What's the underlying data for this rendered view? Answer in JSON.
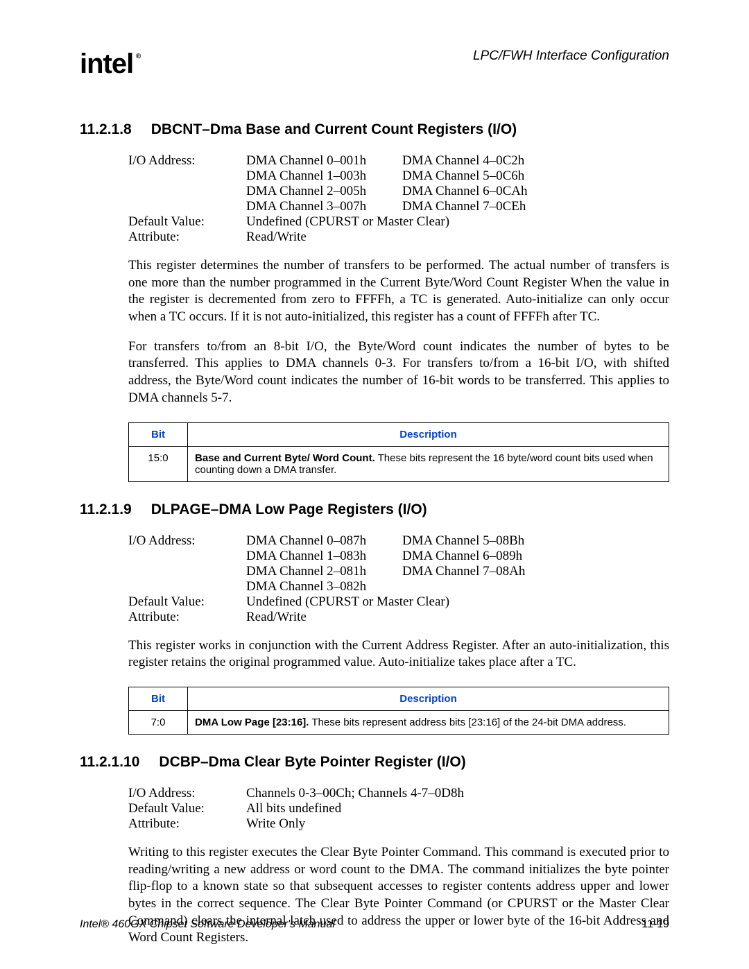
{
  "header": {
    "logo_text": "intel",
    "reg": "®",
    "right": "LPC/FWH Interface Configuration"
  },
  "table_headers": {
    "bit": "Bit",
    "desc": "Description"
  },
  "s1": {
    "num": "11.2.1.8",
    "title": "DBCNT–Dma Base and Current Count Registers (I/O)",
    "kv": {
      "io_label": "I/O Address:",
      "cols": [
        [
          "DMA Channel 0–001h",
          "DMA Channel 1–003h",
          "DMA Channel 2–005h",
          "DMA Channel 3–007h"
        ],
        [
          "DMA Channel 4–0C2h",
          "DMA Channel 5–0C6h",
          "DMA Channel 6–0CAh",
          "DMA Channel 7–0CEh"
        ]
      ],
      "dv_label": "Default Value:",
      "dv_value": "Undefined (CPURST or Master Clear)",
      "attr_label": "Attribute:",
      "attr_value": "Read/Write"
    },
    "p1": "This register determines the number of transfers to be performed. The actual number of transfers is one more than the number programmed in the Current Byte/Word Count Register When the value in the register is decremented from zero to FFFFh, a TC is generated. Auto-initialize can only occur when a TC occurs. If it is not auto-initialized, this register has a count of FFFFh after TC.",
    "p2": "For transfers to/from an 8-bit I/O, the Byte/Word count indicates the number of bytes to be transferred. This applies to DMA channels 0-3. For transfers to/from a 16-bit I/O, with shifted address, the Byte/Word count indicates the number of 16-bit words to be transferred. This applies to DMA channels 5-7.",
    "row": {
      "bit": "15:0",
      "bold": "Base and Current Byte/ Word Count.",
      "rest": " These bits represent the 16 byte/word count bits used when counting down a DMA transfer."
    }
  },
  "s2": {
    "num": "11.2.1.9",
    "title": "DLPAGE–DMA Low Page Registers (I/O)",
    "kv": {
      "io_label": "I/O Address:",
      "cols": [
        [
          "DMA Channel 0–087h",
          "DMA Channel 1–083h",
          "DMA Channel 2–081h",
          "DMA Channel 3–082h"
        ],
        [
          "DMA Channel 5–08Bh",
          "DMA Channel 6–089h",
          "DMA Channel 7–08Ah"
        ]
      ],
      "dv_label": "Default Value:",
      "dv_value": "Undefined (CPURST or Master Clear)",
      "attr_label": "Attribute:",
      "attr_value": "Read/Write"
    },
    "p1": "This register works in conjunction with the Current Address Register. After an auto-initialization, this register retains the original programmed value. Auto-initialize takes place after a TC.",
    "row": {
      "bit": "7:0",
      "bold": "DMA Low Page [23:16].",
      "rest": " These bits represent address bits [23:16] of the 24-bit DMA address."
    }
  },
  "s3": {
    "num": "11.2.1.10",
    "title": "DCBP–Dma Clear Byte Pointer Register (I/O)",
    "kv": {
      "io_label": "I/O Address:",
      "io_value": "Channels 0-3–00Ch; Channels 4-7–0D8h",
      "dv_label": "Default Value:",
      "dv_value": "All bits undefined",
      "attr_label": "Attribute:",
      "attr_value": "Write Only"
    },
    "p1": "Writing to this register executes the Clear Byte Pointer Command. This command is executed prior to reading/writing a new address or word count to the DMA. The command initializes the byte pointer flip-flop to a known state so that subsequent accesses to register contents address upper and lower bytes in the correct sequence. The Clear Byte Pointer Command (or CPURST or the Master Clear Command) clears the internal latch used to address the upper or lower byte of the 16-bit Address and Word Count Registers."
  },
  "footer": {
    "left": "Intel® 460GX Chipset Software Developer's Manual",
    "right": "11-19"
  }
}
